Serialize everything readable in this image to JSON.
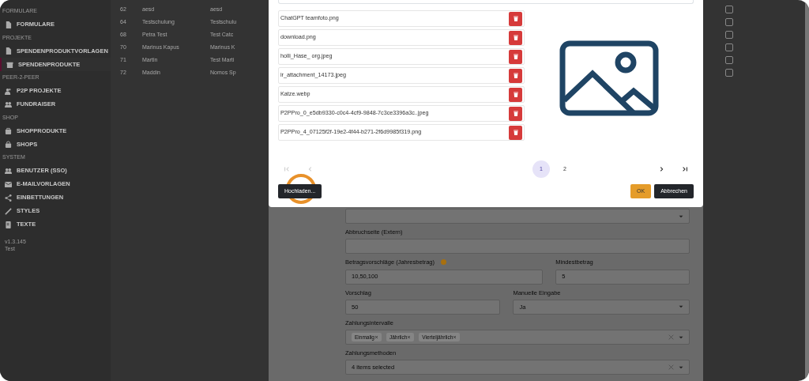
{
  "sidebar": {
    "sections": [
      {
        "title": "FORMULARE",
        "items": [
          {
            "label": "FORMULARE",
            "selected": false
          }
        ]
      },
      {
        "title": "PROJEKTE",
        "items": [
          {
            "label": "SPENDENPRODUKTVORLAGEN",
            "selected": false
          },
          {
            "label": "SPENDENPRODUKTE",
            "selected": true
          }
        ]
      },
      {
        "title": "PEER-2-PEER",
        "items": [
          {
            "label": "P2P PROJEKTE",
            "selected": false
          },
          {
            "label": "FUNDRAISER",
            "selected": false
          }
        ]
      },
      {
        "title": "SHOP",
        "items": [
          {
            "label": "SHOPPRODUKTE",
            "selected": false
          },
          {
            "label": "SHOPS",
            "selected": false
          }
        ]
      },
      {
        "title": "SYSTEM",
        "items": [
          {
            "label": "BENUTZER (SSO)",
            "selected": false
          },
          {
            "label": "E-MAILVORLAGEN",
            "selected": false
          },
          {
            "label": "EINBETTUNGEN",
            "selected": false
          },
          {
            "label": "STYLES",
            "selected": false
          },
          {
            "label": "TEXTE",
            "selected": false
          }
        ]
      }
    ],
    "footer": [
      "v1.3.145",
      "Test"
    ]
  },
  "table": {
    "rows": [
      [
        "62",
        "aesd",
        "aesd"
      ],
      [
        "64",
        "Testschulung",
        "Testschulu"
      ],
      [
        "68",
        "Petra Test",
        "Test Catc"
      ],
      [
        "70",
        "Marinus Kapus",
        "Marinus K"
      ],
      [
        "71",
        "Martin",
        "Test Marti"
      ],
      [
        "72",
        "Maddin",
        "Nomos Sp"
      ]
    ]
  },
  "modal": {
    "files": [
      "ChatGPT teamfoto.png",
      "download.png",
      "holli_Hase_ org.jpeg",
      "ir_attachment_14173.jpeg",
      "Katze.webp",
      "P2PPro_0_e5db9330-c0c4-4cf9-9848-7c3ce3396a3c..jpeg",
      "P2PPro_4_07125f2f-19e2-4f44-b271-2f6d9985f319.png"
    ],
    "pagination": {
      "nav": [
        {
          "kind": "first",
          "disabled": true
        },
        {
          "kind": "prev",
          "disabled": true
        },
        {
          "kind": "next",
          "disabled": false
        },
        {
          "kind": "last",
          "disabled": false
        }
      ],
      "pages": [
        {
          "label": "1",
          "selected": true
        },
        {
          "label": "2",
          "selected": false
        }
      ]
    },
    "upload_button": "Hochladen...",
    "ok_button": "OK",
    "cancel_button": "Abbrechen"
  },
  "form": {
    "rows": [
      [
        {
          "kind": "select"
        }
      ],
      [
        {
          "kind": "input",
          "label": "Abbruchseite (Extern)"
        }
      ],
      [
        {
          "kind": "input",
          "label": "Betragsvorschläge (Jahresbetrag)",
          "info": true,
          "value": "10,50,100"
        },
        {
          "kind": "input",
          "label": "Mindestbetrag",
          "value": "5"
        }
      ],
      [
        {
          "kind": "input",
          "label": "Vorschlag",
          "value": "50"
        },
        {
          "kind": "select",
          "label": "Manuelle Eingabe",
          "value": "Ja"
        }
      ],
      [
        {
          "kind": "tags",
          "label": "Zahlungsintervalle",
          "tags": [
            "Einmalig",
            "Jährlich",
            "Vierteljährlich"
          ]
        }
      ],
      [
        {
          "kind": "multiselect",
          "label": "Zahlungsmethoden",
          "value": "4 items selected"
        }
      ]
    ]
  }
}
